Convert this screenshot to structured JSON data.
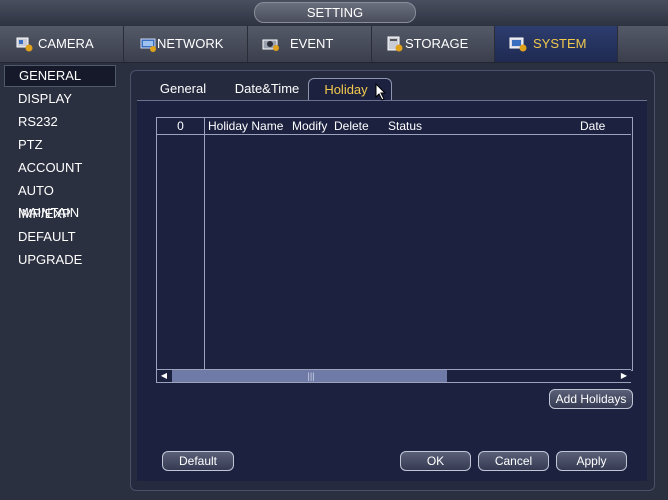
{
  "window": {
    "title": "SETTING"
  },
  "topnav": {
    "tabs": [
      {
        "label": "CAMERA",
        "icon": "camera-icon"
      },
      {
        "label": "NETWORK",
        "icon": "network-icon"
      },
      {
        "label": "EVENT",
        "icon": "event-icon"
      },
      {
        "label": "STORAGE",
        "icon": "storage-icon"
      },
      {
        "label": "SYSTEM",
        "icon": "system-icon",
        "active": true
      }
    ]
  },
  "sidebar": {
    "items": [
      {
        "label": "GENERAL",
        "active": true
      },
      {
        "label": "DISPLAY"
      },
      {
        "label": "RS232"
      },
      {
        "label": "PTZ"
      },
      {
        "label": "ACCOUNT"
      },
      {
        "label": "AUTO MAINTAIN"
      },
      {
        "label": "IMP/EXP"
      },
      {
        "label": "DEFAULT"
      },
      {
        "label": "UPGRADE"
      }
    ]
  },
  "subtabs": [
    {
      "label": "General"
    },
    {
      "label": "Date&Time"
    },
    {
      "label": "Holiday",
      "active": true
    }
  ],
  "table": {
    "count": "0",
    "columns": [
      "Holiday Name",
      "Modify",
      "Delete",
      "Status",
      "Date"
    ],
    "rows": []
  },
  "buttons": {
    "add_holidays": "Add Holidays",
    "default": "Default",
    "ok": "OK",
    "cancel": "Cancel",
    "apply": "Apply"
  },
  "colors": {
    "active_text": "#f2c94c",
    "panel": "#1c2140",
    "background": "#2b3040"
  }
}
